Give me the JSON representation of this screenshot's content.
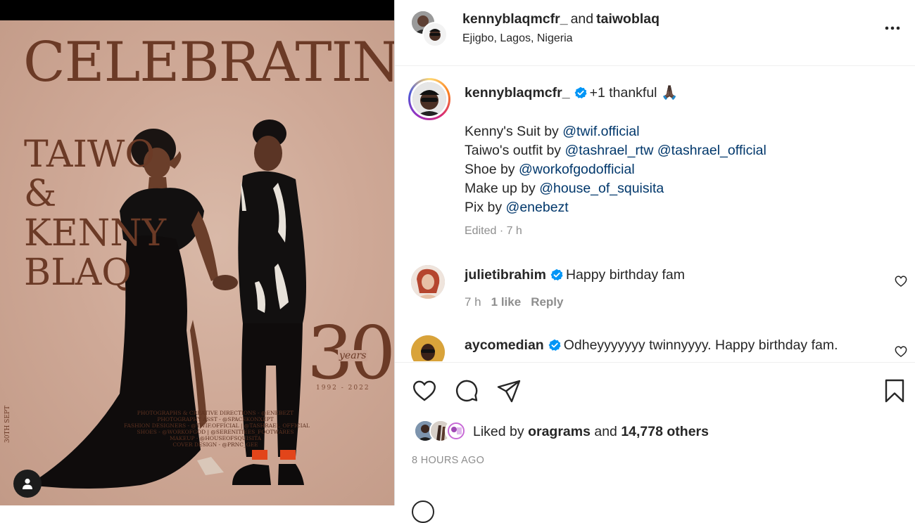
{
  "post_media": {
    "poster_title": "CELEBRATING",
    "poster_names": [
      "TAIWO",
      "&",
      "KENNY",
      "BLAQ"
    ],
    "poster_age": "30",
    "poster_years": "years",
    "poster_range": "1992 - 2022",
    "poster_date": "30TH SEPT",
    "credits": [
      "PHOTOGRAPHS & CREATIVE DIRECTIONS - @ENEBEZT",
      "PHOTOGRAPHY ASST - @SPACEKONXEPT",
      "FASHION DESIGNERS - @TWIF.OFFICIAL | @TASHRAEL_OFFICIAL",
      "SHOES - @WORKOFGOD | @SERENITIEES_FOOTWARES",
      "MAKEUP - @HOUSEOFSQUISITA",
      "COVER DESIGN - @PRNC_GEE"
    ]
  },
  "header": {
    "user1": "kennyblaqmcfr_",
    "and": "and",
    "user2": "taiwoblaq",
    "location": "Ejigbo, Lagos, Nigeria"
  },
  "caption": {
    "username": "kennyblaqmcfr_",
    "text": "+1 thankful",
    "emoji": "🙏🏿",
    "lines": [
      {
        "prefix": "Kenny's Suit by ",
        "mentions": [
          "@twif.official"
        ]
      },
      {
        "prefix": "Taiwo's outfit by ",
        "mentions": [
          "@tashrael_rtw",
          "@tashrael_official"
        ]
      },
      {
        "prefix": "Shoe by ",
        "mentions": [
          "@workofgodofficial"
        ]
      },
      {
        "prefix": "Make up by ",
        "mentions": [
          "@house_of_squisita"
        ]
      },
      {
        "prefix": "Pix by ",
        "mentions": [
          "@enebezt"
        ]
      }
    ],
    "edited": "Edited · 7 h"
  },
  "comments": [
    {
      "username": "julietibrahim",
      "text": "Happy birthday fam",
      "time": "7 h",
      "likes": "1 like",
      "reply": "Reply"
    },
    {
      "username": "aycomedian",
      "text": "Odheyyyyyyy twinnyyyy. Happy birthday fam."
    }
  ],
  "likes": {
    "prefix": "Liked by",
    "user": "oragrams",
    "and": "and",
    "count": "14,778 others"
  },
  "timestamp": "8 HOURS AGO",
  "icons": {
    "more": "more-options-icon",
    "like": "heart-icon",
    "comment": "comment-icon",
    "share": "share-icon",
    "save": "bookmark-icon",
    "verified": "verified-badge-icon",
    "user_tag": "user-tag-icon"
  },
  "colors": {
    "mention": "#00376b",
    "verified": "#0095f6",
    "poster_bg": "#cfa997",
    "poster_text": "#6b3a26"
  }
}
